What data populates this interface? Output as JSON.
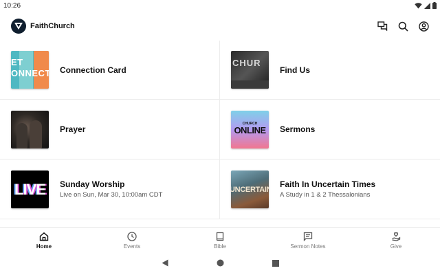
{
  "status_bar": {
    "time": "10:26"
  },
  "app": {
    "title": "FaithChurch"
  },
  "tiles": [
    {
      "title": "Connection Card",
      "subtitle": "",
      "thumb_text": "ET\nONNECTE"
    },
    {
      "title": "Find Us",
      "subtitle": "",
      "thumb_text": "CHUR"
    },
    {
      "title": "Prayer",
      "subtitle": ""
    },
    {
      "title": "Sermons",
      "subtitle": "",
      "thumb_small": "CHURCH",
      "thumb_text": "ONLINE"
    },
    {
      "title": "Sunday Worship",
      "subtitle": "Live on Sun, Mar 30, 10:00am CDT",
      "thumb_text": "LIVE"
    },
    {
      "title": "Faith In Uncertain Times",
      "subtitle": "A Study in 1 & 2 Thessalonians",
      "thumb_text": "UNCERTAIN"
    }
  ],
  "nav": [
    {
      "label": "Home",
      "icon": "home-icon",
      "active": true
    },
    {
      "label": "Events",
      "icon": "clock-icon"
    },
    {
      "label": "Bible",
      "icon": "book-icon"
    },
    {
      "label": "Sermon Notes",
      "icon": "notes-icon"
    },
    {
      "label": "Give",
      "icon": "give-icon"
    }
  ],
  "colors": {
    "accent": "#0f1e2e",
    "text": "#111111",
    "muted": "#555555"
  }
}
